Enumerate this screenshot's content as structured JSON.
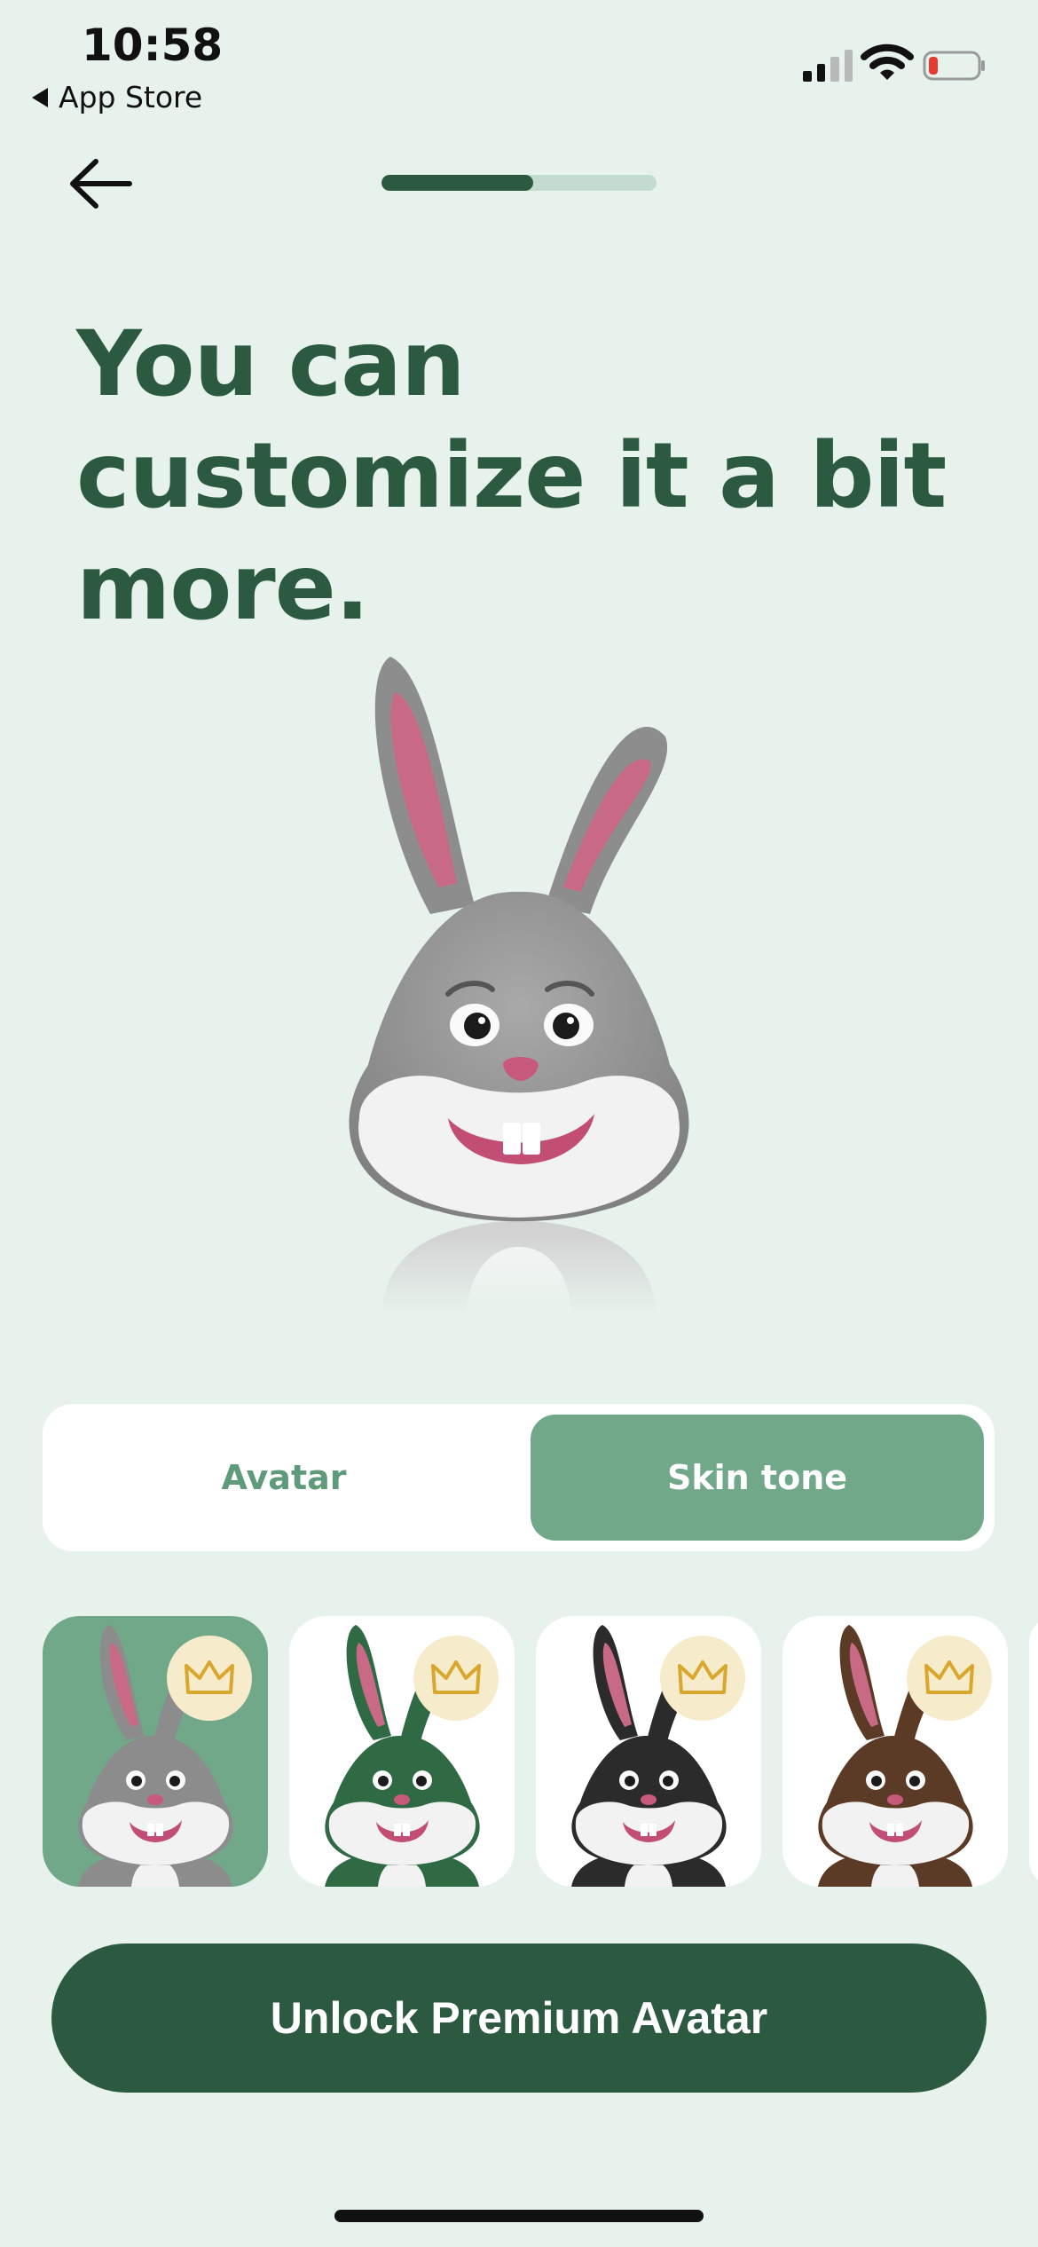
{
  "status_bar": {
    "time": "10:58",
    "back_app": "App Store"
  },
  "onboarding": {
    "progress": 0.55
  },
  "headline": "You can customize it a bit more.",
  "segmented": {
    "avatar": "Avatar",
    "skin_tone": "Skin tone",
    "selected": "skin_tone"
  },
  "skin_tones": [
    {
      "name": "grey",
      "color": "#8c8c8c",
      "selected": true,
      "premium": true
    },
    {
      "name": "green",
      "color": "#2f6a45",
      "selected": false,
      "premium": true
    },
    {
      "name": "black",
      "color": "#2b2b2b",
      "selected": false,
      "premium": true
    },
    {
      "name": "brown",
      "color": "#5b3a26",
      "selected": false,
      "premium": true
    }
  ],
  "cta": {
    "label": "Unlock Premium Avatar"
  },
  "colors": {
    "brand_dark": "#2c5a40",
    "brand_mid": "#71a88a",
    "background": "#e7f2ec",
    "crown": "#d9a72e"
  }
}
